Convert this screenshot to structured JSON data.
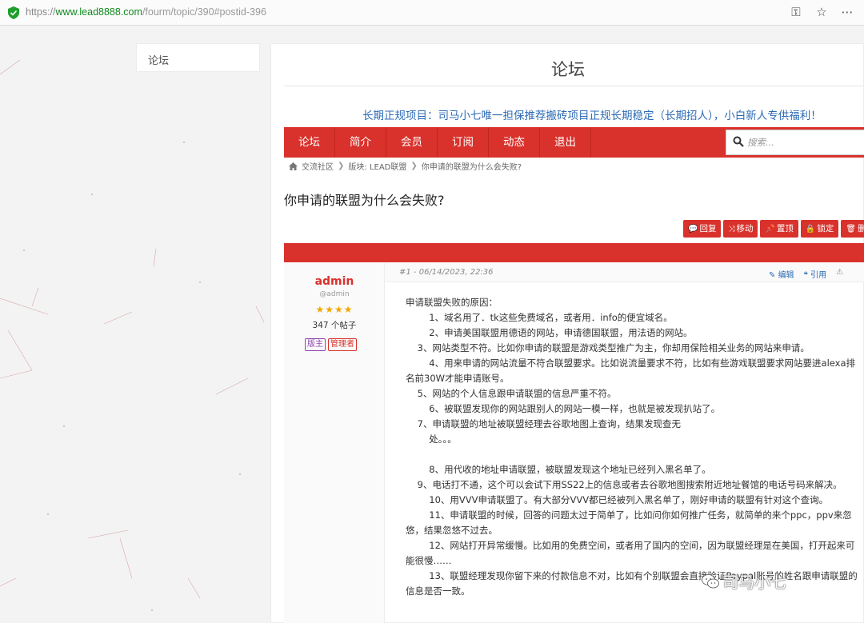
{
  "browser": {
    "url_scheme": "https://",
    "url_host": "www.lead8888.com",
    "url_path": "/fourm/topic/390#postid-396"
  },
  "sidebar": {
    "label": "论坛"
  },
  "header": {
    "title": "论坛",
    "promo": "长期正规项目：司马小七唯一担保推荐搬砖项目正规长期稳定（长期招人），小白新人专供福利！"
  },
  "nav": {
    "items": [
      "论坛",
      "简介",
      "会员",
      "订阅",
      "动态",
      "退出"
    ],
    "search_placeholder": "搜索..."
  },
  "breadcrumb": [
    "交流社区",
    "版块: LEAD联盟",
    "你申请的联盟为什么会失败?"
  ],
  "topic": {
    "title": "你申请的联盟为什么会失败?"
  },
  "actions": [
    "回复",
    "移动",
    "置顶",
    "锁定",
    "删"
  ],
  "post": {
    "number": "#1 - 06/14/2023, 22:36",
    "edit": "编辑",
    "quote": "引用",
    "author": {
      "name": "admin",
      "handle": "@admin",
      "stars": "★★★★",
      "post_count": "347 个帖子",
      "badges": [
        "版主",
        "管理者"
      ]
    },
    "paragraphs": [
      "申请联盟失败的原因：",
      "        1、域名用了．tk这些免费域名，或者用．info的便宜域名。",
      "        2、申请美国联盟用德语的网站，申请德国联盟，用法语的网站。",
      "    3、网站类型不符。比如你申请的联盟是游戏类型推广为主，你却用保险相关业务的网站来申请。",
      "        4、用来申请的网站流量不符合联盟要求。比如说流量要求不符，比如有些游戏联盟要求网站要进alexa排名前30W才能申请账号。",
      "    5、网站的个人信息跟申请联盟的信息严重不符。",
      "        6、被联盟发现你的网站跟别人的网站一模一样，也就是被发现扒站了。",
      "    7、申请联盟的地址被联盟经理去谷歌地图上查询，结果发现查无",
      "        处。。。",
      " ",
      "        8、用代收的地址申请联盟，被联盟发现这个地址已经列入黑名单了。",
      "    9、电话打不通，这个可以会试下用SS22上的信息或者去谷歌地图搜索附近地址餐馆的电话号码来解决。",
      "        10、用VVV申请联盟了。有大部分VVV都已经被列入黑名单了，刚好申请的联盟有针对这个查询。",
      "        11、申请联盟的时候，回答的问题太过于简单了，比如问你如何推广任务，就简单的来个ppc，ppv来忽悠，结果忽悠不过去。",
      "        12、网站打开异常缓慢。比如用的免费空间，或者用了国内的空间，因为联盟经理是在美国，打开起来可能很慢……",
      "        13、联盟经理发现你留下来的付款信息不对，比如有个别联盟会直接验证Paypal账号的姓名跟申请联盟的信息是否一致。"
    ]
  },
  "watermark": {
    "text": "司马小七"
  },
  "colors": {
    "brand_red": "#d9312b",
    "link_blue": "#2d6bb5"
  }
}
